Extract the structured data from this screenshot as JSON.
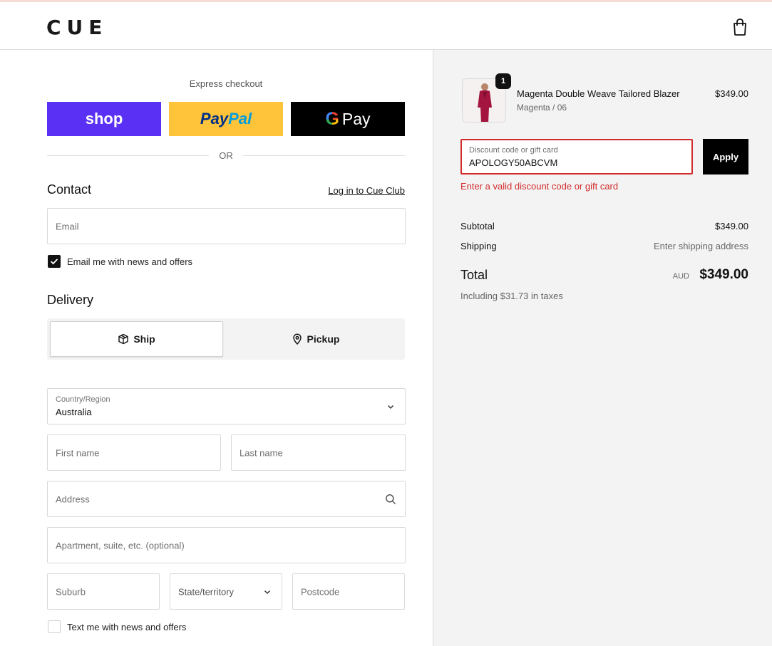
{
  "brand": {
    "logo": "CUE"
  },
  "express": {
    "title": "Express checkout",
    "shop_label": "shop",
    "paypal_label_1": "Pay",
    "paypal_label_2": "Pal",
    "gpay_g": "G",
    "gpay_label": "Pay",
    "or_label": "OR"
  },
  "contact": {
    "title": "Contact",
    "login_link": "Log in to Cue Club",
    "email_placeholder": "Email",
    "news_label": "Email me with news and offers",
    "news_checked": true
  },
  "delivery": {
    "title": "Delivery",
    "ship_label": "Ship",
    "pickup_label": "Pickup",
    "selected": "Ship",
    "country_label": "Country/Region",
    "country_value": "Australia",
    "first_name_placeholder": "First name",
    "last_name_placeholder": "Last name",
    "address_placeholder": "Address",
    "apartment_placeholder": "Apartment, suite, etc. (optional)",
    "suburb_placeholder": "Suburb",
    "state_placeholder": "State/territory",
    "postcode_placeholder": "Postcode",
    "sms_label": "Text me with news and offers",
    "sms_checked": false
  },
  "order": {
    "item": {
      "name": "Magenta Double Weave Tailored Blazer",
      "variant": "Magenta / 06",
      "price": "$349.00",
      "quantity": "1"
    },
    "discount": {
      "label": "Discount code or gift card",
      "value": "APOLOGY50ABCVM",
      "apply_label": "Apply",
      "error": "Enter a valid discount code or gift card"
    },
    "subtotal_label": "Subtotal",
    "subtotal_value": "$349.00",
    "shipping_label": "Shipping",
    "shipping_value": "Enter shipping address",
    "total_label": "Total",
    "currency": "AUD",
    "total_value": "$349.00",
    "tax_note": "Including $31.73 in taxes"
  },
  "colors": {
    "shop": "#5a31f4",
    "paypal": "#ffc439",
    "error": "#d22b2b",
    "summary_bg": "#f3f3f3"
  }
}
